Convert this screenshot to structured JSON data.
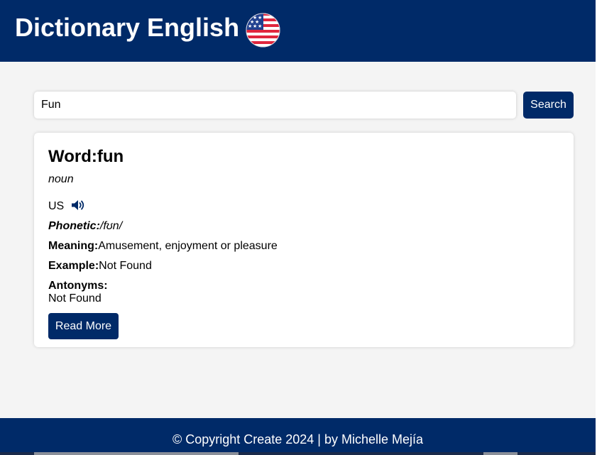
{
  "header": {
    "title": "Dictionary English",
    "flag_icon": "us-flag-icon"
  },
  "search": {
    "value": "Fun",
    "button_label": "Search"
  },
  "result": {
    "word_label": "Word:",
    "word": "fun",
    "part_of_speech": "noun",
    "audio_label": "US",
    "audio_icon": "speaker-icon",
    "phonetic_label": "Phonetic:",
    "phonetic": "/fʊn/",
    "meaning_label": "Meaning:",
    "meaning": "Amusement, enjoyment or pleasure",
    "example_label": "Example:",
    "example": "Not Found",
    "antonyms_label": "Antonyms:",
    "antonyms": "Not Found",
    "read_more_label": "Read More"
  },
  "footer": {
    "text": "© Copyright Create 2024 | by Michelle Mejía"
  },
  "colors": {
    "brand": "#002a68",
    "background": "#f4f4f4",
    "card": "#ffffff"
  }
}
